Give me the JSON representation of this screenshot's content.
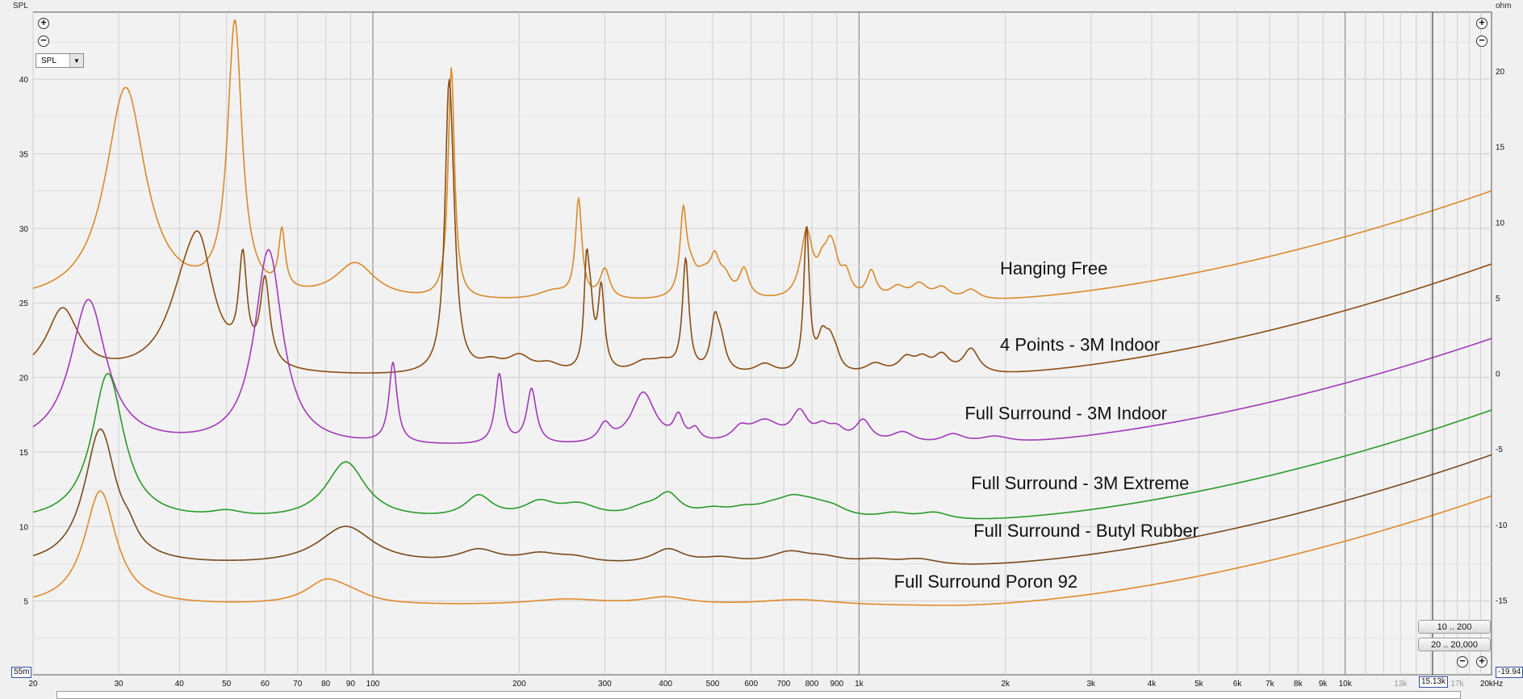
{
  "left_axis_unit": "SPL",
  "right_axis_unit": "ohm",
  "spl_select": {
    "value": "SPL"
  },
  "zoom": {
    "in_symbol": "+",
    "out_symbol": "−"
  },
  "range_buttons": [
    "10 .. 200",
    "20 .. 20,000"
  ],
  "readouts": {
    "left_min": "55m",
    "right_min": "-19.94",
    "cursor_freq": "15.13k"
  },
  "colors": {
    "background": "#f2f2f2",
    "grid": "#cfcfcf",
    "grid_major": "#7a7a7a",
    "cursor": "#444444"
  },
  "chart_data": {
    "type": "line",
    "xscale": "log",
    "xlim": [
      20,
      20000
    ],
    "ylim_left": [
      0.055,
      44.5
    ],
    "ylim_right": [
      -19.94,
      23.9
    ],
    "x_tick_labels": [
      {
        "v": 20,
        "t": "20"
      },
      {
        "v": 30,
        "t": "30"
      },
      {
        "v": 40,
        "t": "40"
      },
      {
        "v": 50,
        "t": "50"
      },
      {
        "v": 60,
        "t": "60"
      },
      {
        "v": 70,
        "t": "70"
      },
      {
        "v": 80,
        "t": "80"
      },
      {
        "v": 90,
        "t": "90"
      },
      {
        "v": 100,
        "t": "100"
      },
      {
        "v": 200,
        "t": "200"
      },
      {
        "v": 300,
        "t": "300"
      },
      {
        "v": 400,
        "t": "400"
      },
      {
        "v": 500,
        "t": "500"
      },
      {
        "v": 600,
        "t": "600"
      },
      {
        "v": 700,
        "t": "700"
      },
      {
        "v": 800,
        "t": "800"
      },
      {
        "v": 900,
        "t": "900"
      },
      {
        "v": 1000,
        "t": "1k"
      },
      {
        "v": 2000,
        "t": "2k"
      },
      {
        "v": 3000,
        "t": "3k"
      },
      {
        "v": 4000,
        "t": "4k"
      },
      {
        "v": 5000,
        "t": "5k"
      },
      {
        "v": 6000,
        "t": "6k"
      },
      {
        "v": 7000,
        "t": "7k"
      },
      {
        "v": 8000,
        "t": "8k"
      },
      {
        "v": 9000,
        "t": "9k"
      },
      {
        "v": 10000,
        "t": "10k"
      },
      {
        "v": 13000,
        "t": "13k"
      },
      {
        "v": 17000,
        "t": "17k"
      },
      {
        "v": 20000,
        "t": "20kHz"
      }
    ],
    "y_left_ticks": [
      5,
      10,
      15,
      20,
      25,
      30,
      35,
      40
    ],
    "y_right_ticks": [
      -15,
      -10,
      -5,
      0,
      5,
      10,
      15,
      20
    ],
    "cursor_x": 15130,
    "grid": true,
    "series": [
      {
        "name": "Hanging Free",
        "color": "#d98a2b",
        "base": 25.0,
        "hf": 7.5,
        "label_at": [
          1950,
          26.9
        ],
        "peaks": [
          [
            31,
            14.3,
            0.05
          ],
          [
            52,
            18.2,
            0.018
          ],
          [
            65,
            3.9,
            0.008
          ],
          [
            92,
            2.4,
            0.05
          ],
          [
            145,
            15.5,
            0.008
          ],
          [
            235,
            0.6,
            0.04
          ],
          [
            265,
            6.6,
            0.008
          ],
          [
            300,
            2.0,
            0.012
          ],
          [
            435,
            5.3,
            0.008
          ],
          [
            450,
            1.5,
            0.015
          ],
          [
            480,
            1.3,
            0.02
          ],
          [
            505,
            2.1,
            0.012
          ],
          [
            530,
            1.2,
            0.015
          ],
          [
            580,
            1.9,
            0.012
          ],
          [
            780,
            4.4,
            0.015
          ],
          [
            840,
            1.6,
            0.012
          ],
          [
            870,
            2.3,
            0.012
          ],
          [
            890,
            1.5,
            0.012
          ],
          [
            940,
            1.5,
            0.012
          ],
          [
            1060,
            1.8,
            0.012
          ],
          [
            1200,
            0.8,
            0.02
          ],
          [
            1330,
            1.0,
            0.02
          ],
          [
            1480,
            0.8,
            0.02
          ],
          [
            1700,
            0.7,
            0.02
          ]
        ]
      },
      {
        "name": "4 Points - 3M Indoor",
        "color": "#8a4d14",
        "base": 20.0,
        "hf": 7.6,
        "label_at": [
          1950,
          21.8
        ],
        "peaks": [
          [
            23,
            4.4,
            0.04
          ],
          [
            41,
            4.2,
            0.05
          ],
          [
            44,
            6.4,
            0.035
          ],
          [
            54,
            6.7,
            0.01
          ],
          [
            60,
            5.7,
            0.012
          ],
          [
            143,
            12.0,
            0.009
          ],
          [
            145,
            9.2,
            0.012
          ],
          [
            175,
            0.7,
            0.03
          ],
          [
            200,
            1.1,
            0.03
          ],
          [
            230,
            0.6,
            0.03
          ],
          [
            275,
            6.1,
            0.006
          ],
          [
            280,
            3.6,
            0.008
          ],
          [
            295,
            5.5,
            0.008
          ],
          [
            360,
            0.7,
            0.03
          ],
          [
            395,
            0.7,
            0.03
          ],
          [
            440,
            7.5,
            0.008
          ],
          [
            505,
            3.2,
            0.01
          ],
          [
            520,
            1.8,
            0.012
          ],
          [
            640,
            0.7,
            0.025
          ],
          [
            780,
            9.7,
            0.007
          ],
          [
            840,
            2.1,
            0.012
          ],
          [
            870,
            1.6,
            0.012
          ],
          [
            895,
            0.9,
            0.012
          ],
          [
            1080,
            0.7,
            0.025
          ],
          [
            1250,
            1.0,
            0.02
          ],
          [
            1350,
            0.9,
            0.02
          ],
          [
            1480,
            1.2,
            0.02
          ],
          [
            1700,
            1.7,
            0.02
          ]
        ]
      },
      {
        "name": "Full Surround - 3M Indoor",
        "color": "#a23ab8",
        "base": 15.3,
        "hf": 7.3,
        "label_at": [
          1650,
          17.2
        ],
        "peaks": [
          [
            26,
            9.8,
            0.045
          ],
          [
            61,
            13.1,
            0.035
          ],
          [
            110,
            5.4,
            0.01
          ],
          [
            182,
            4.7,
            0.01
          ],
          [
            212,
            3.7,
            0.012
          ],
          [
            300,
            1.2,
            0.015
          ],
          [
            360,
            3.5,
            0.03
          ],
          [
            425,
            1.6,
            0.012
          ],
          [
            460,
            0.8,
            0.012
          ],
          [
            570,
            0.8,
            0.02
          ],
          [
            640,
            1.5,
            0.04
          ],
          [
            755,
            1.9,
            0.02
          ],
          [
            840,
            0.9,
            0.02
          ],
          [
            900,
            0.8,
            0.02
          ],
          [
            1020,
            1.5,
            0.02
          ],
          [
            1230,
            0.8,
            0.03
          ],
          [
            1560,
            0.7,
            0.03
          ],
          [
            1900,
            0.5,
            0.04
          ]
        ]
      },
      {
        "name": "Full Surround - 3M Extreme",
        "color": "#2a9a2a",
        "base": 10.3,
        "hf": 7.5,
        "label_at": [
          1700,
          12.5
        ],
        "peaks": [
          [
            28.5,
            9.9,
            0.04
          ],
          [
            50,
            0.4,
            0.04
          ],
          [
            88,
            3.9,
            0.05
          ],
          [
            165,
            1.5,
            0.035
          ],
          [
            220,
            1.0,
            0.04
          ],
          [
            265,
            0.9,
            0.05
          ],
          [
            360,
            0.6,
            0.04
          ],
          [
            405,
            1.5,
            0.03
          ],
          [
            500,
            0.5,
            0.04
          ],
          [
            580,
            0.5,
            0.04
          ],
          [
            660,
            0.5,
            0.04
          ],
          [
            730,
            1.0,
            0.04
          ],
          [
            800,
            0.6,
            0.04
          ],
          [
            880,
            0.6,
            0.04
          ],
          [
            1180,
            0.4,
            0.04
          ],
          [
            1430,
            0.5,
            0.04
          ]
        ]
      },
      {
        "name": "Full Surround - Butyl Rubber",
        "color": "#7a4a1c",
        "base": 7.3,
        "hf": 7.5,
        "label_at": [
          1720,
          9.3
        ],
        "peaks": [
          [
            27.5,
            9.1,
            0.04
          ],
          [
            31.5,
            0.8,
            0.02
          ],
          [
            88,
            2.6,
            0.07
          ],
          [
            165,
            0.9,
            0.05
          ],
          [
            220,
            0.6,
            0.05
          ],
          [
            260,
            0.4,
            0.05
          ],
          [
            405,
            1.0,
            0.04
          ],
          [
            520,
            0.4,
            0.05
          ],
          [
            720,
            0.8,
            0.05
          ],
          [
            850,
            0.4,
            0.05
          ],
          [
            1080,
            0.3,
            0.05
          ],
          [
            1330,
            0.4,
            0.05
          ]
        ]
      },
      {
        "name": "Full Surround Poron 92",
        "color": "#e08a2a",
        "base": 4.65,
        "hf": 7.4,
        "label_at": [
          1180,
          5.9
        ],
        "peaks": [
          [
            27.5,
            7.7,
            0.04
          ],
          [
            80,
            1.5,
            0.05
          ],
          [
            90,
            0.5,
            0.05
          ],
          [
            250,
            0.4,
            0.1
          ],
          [
            400,
            0.5,
            0.06
          ],
          [
            750,
            0.4,
            0.1
          ]
        ]
      }
    ]
  }
}
